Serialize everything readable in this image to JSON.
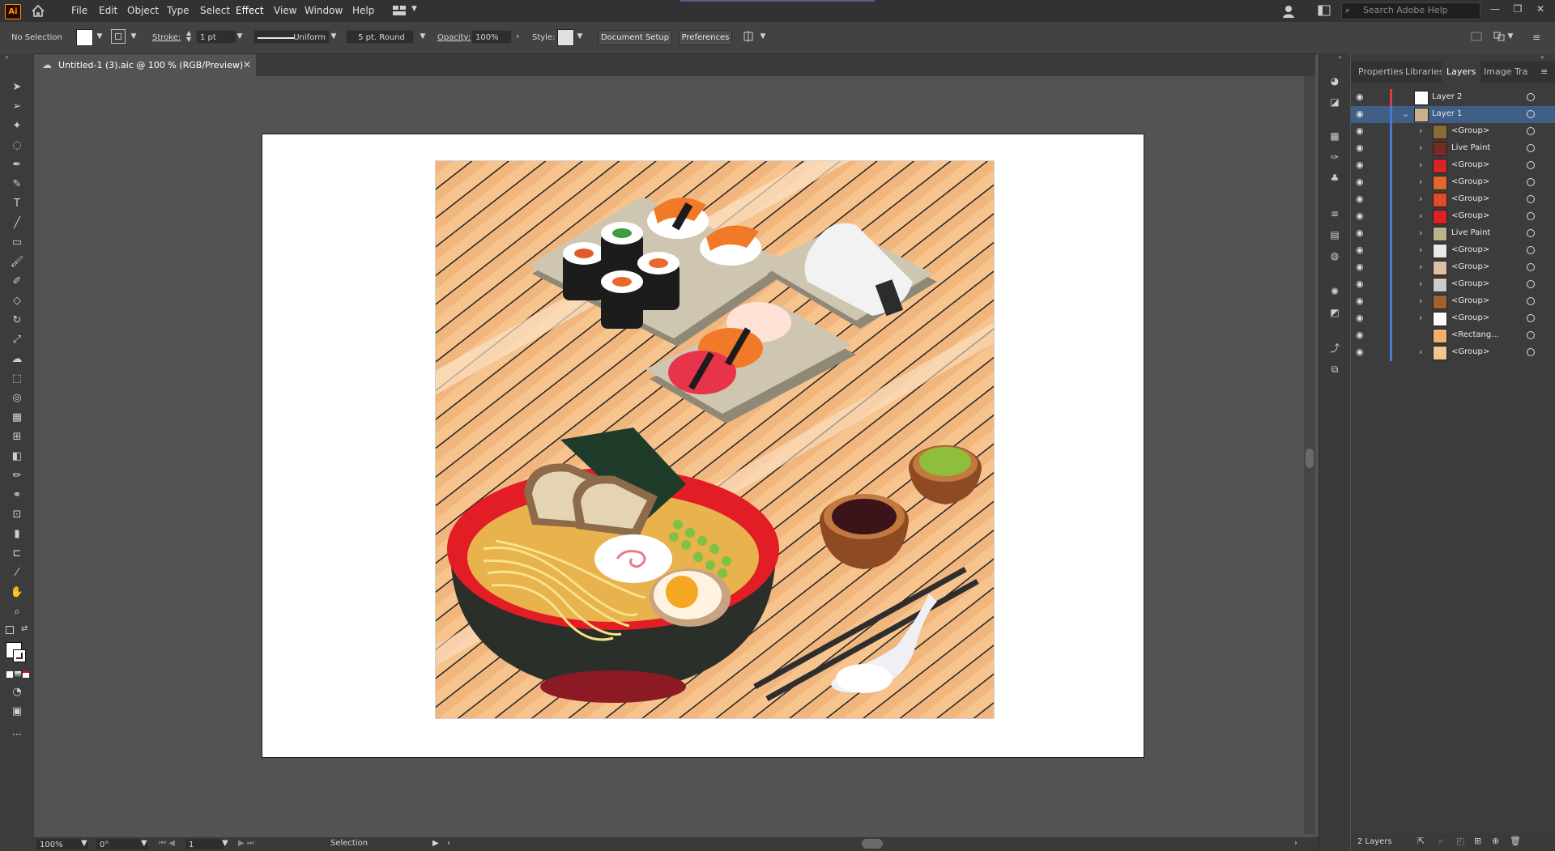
{
  "app": {
    "logo": "Ai"
  },
  "menu": [
    "File",
    "Edit",
    "Object",
    "Type",
    "Select",
    "Effect",
    "View",
    "Window",
    "Help"
  ],
  "search": {
    "placeholder": "Search Adobe Help"
  },
  "control": {
    "selection": "No Selection",
    "stroke_label": "Stroke:",
    "stroke_value": "1 pt",
    "profile": "Uniform",
    "brush": "5 pt. Round",
    "opacity_label": "Opacity:",
    "opacity_value": "100%",
    "style_label": "Style:",
    "document_setup": "Document Setup",
    "preferences": "Preferences"
  },
  "document_tab": {
    "title": "Untitled-1 (3).aic @ 100 % (RGB/Preview)"
  },
  "panel": {
    "tabs": [
      "Properties",
      "Libraries",
      "Layers",
      "Image Tra"
    ],
    "active_tab": "Layers",
    "layers": [
      {
        "name": "Layer 2",
        "color": "#e03a3a"
      },
      {
        "name": "Layer 1",
        "color": "#4a78d6",
        "selected": true
      },
      {
        "name": "<Group>",
        "color": "#4a78d6"
      },
      {
        "name": "Live Paint",
        "color": "#4a78d6"
      },
      {
        "name": "<Group>",
        "color": "#4a78d6"
      },
      {
        "name": "<Group>",
        "color": "#4a78d6"
      },
      {
        "name": "<Group>",
        "color": "#4a78d6"
      },
      {
        "name": "<Group>",
        "color": "#4a78d6"
      },
      {
        "name": "Live Paint",
        "color": "#4a78d6"
      },
      {
        "name": "<Group>",
        "color": "#4a78d6"
      },
      {
        "name": "<Group>",
        "color": "#4a78d6"
      },
      {
        "name": "<Group>",
        "color": "#4a78d6"
      },
      {
        "name": "<Group>",
        "color": "#4a78d6"
      },
      {
        "name": "<Group>",
        "color": "#4a78d6"
      },
      {
        "name": "<Rectang...",
        "color": "#4a78d6"
      },
      {
        "name": "<Group>",
        "color": "#4a78d6"
      }
    ],
    "footer": "2 Layers"
  },
  "status": {
    "zoom": "100%",
    "rotation": "0°",
    "artboard": "1",
    "tool": "Selection"
  }
}
